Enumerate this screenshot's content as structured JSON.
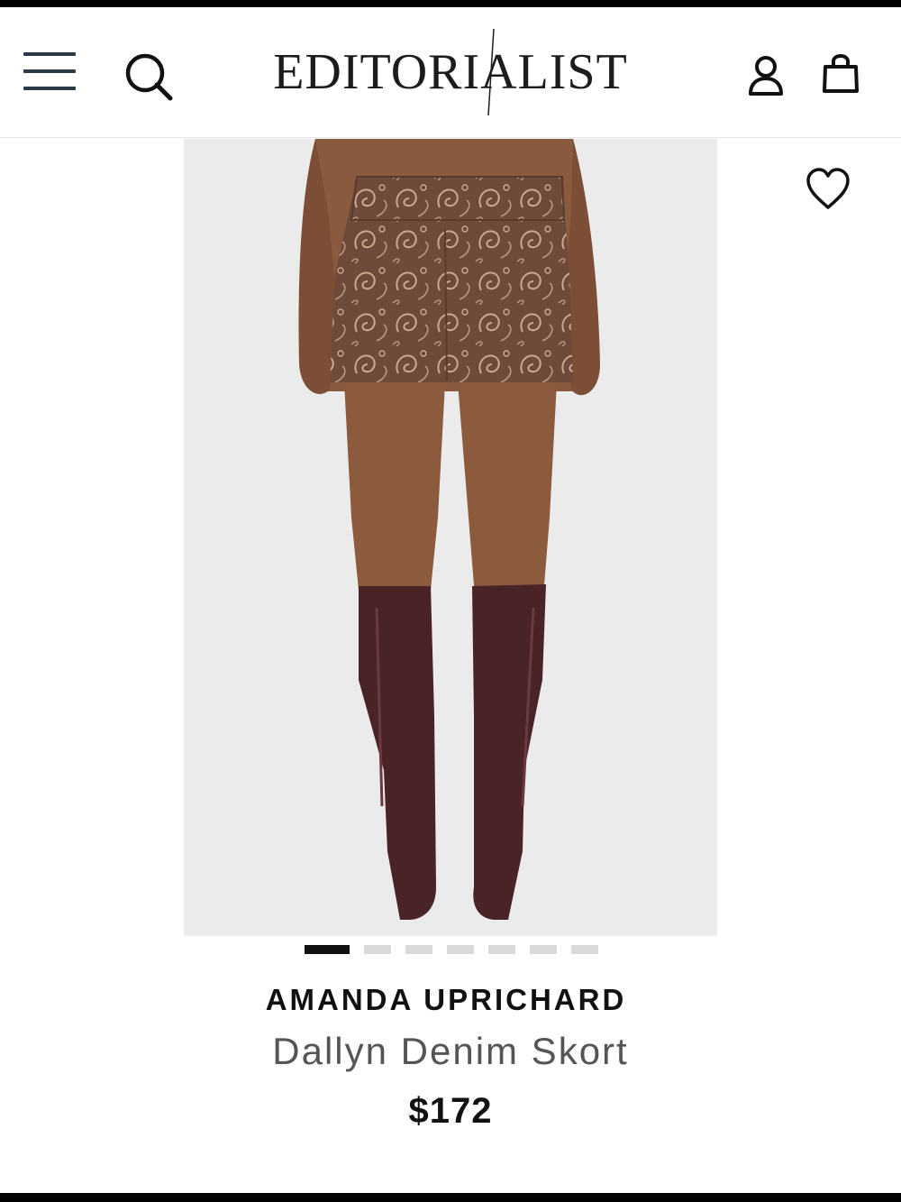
{
  "header": {
    "logo_text": "EDITORIALIST",
    "menu_icon": "hamburger-menu-icon",
    "search_icon": "search-icon",
    "account_icon": "user-account-icon",
    "bag_icon": "shopping-bag-icon"
  },
  "product": {
    "brand": "AMANDA UPRICHARD",
    "name": "Dallyn Denim Skort",
    "price": "$172",
    "wishlist_icon": "heart-icon",
    "image_alt": "product-photo"
  },
  "carousel": {
    "total_images": 7,
    "active_index": 0
  },
  "colors": {
    "header_icon": "#2b3a44",
    "text_primary": "#111111",
    "text_secondary": "#555555",
    "dot_inactive": "#d9d9d9",
    "image_background": "#ebebeb"
  }
}
